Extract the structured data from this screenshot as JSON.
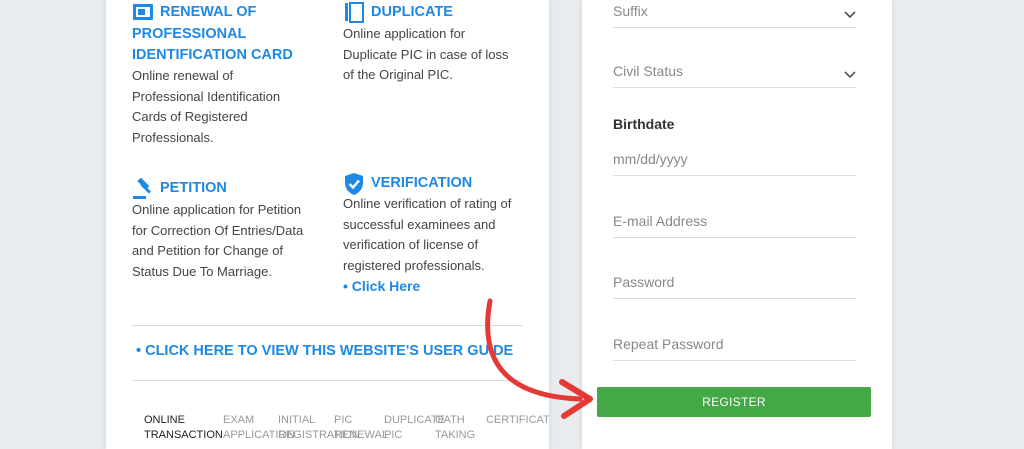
{
  "services": [
    {
      "id": "renewal",
      "icon": "id-card-icon",
      "title_lines": [
        "RENEWAL OF",
        "PROFESSIONAL",
        "IDENTIFICATION CARD"
      ],
      "desc_lines": [
        "Online renewal of",
        "Professional Identification",
        "Cards of Registered",
        "Professionals."
      ]
    },
    {
      "id": "duplicate",
      "icon": "duplicate-icon",
      "title_lines": [
        "DUPLICATE"
      ],
      "desc_lines": [
        "Online application for",
        "Duplicate PIC in case of loss",
        "of the Original PIC."
      ]
    },
    {
      "id": "petition",
      "icon": "gavel-icon",
      "title_lines": [
        "PETITION"
      ],
      "desc_lines": [
        "Online application for Petition",
        "for Correction Of Entries/Data",
        "and Petition for Change of",
        "Status Due To Marriage."
      ]
    },
    {
      "id": "verification",
      "icon": "verified-shield-icon",
      "title_lines": [
        "VERIFICATION"
      ],
      "desc_lines": [
        "Online verification of rating of",
        "successful examinees and",
        "verification of license of",
        "registered professionals."
      ],
      "link": "• Click Here"
    }
  ],
  "user_guide_link": "• CLICK HERE TO VIEW THIS WEBSITE'S USER GUIDE",
  "tabs": [
    {
      "lines": [
        "ONLINE",
        "TRANSACTION"
      ],
      "active": true
    },
    {
      "lines": [
        "EXAM",
        "APPLICATION"
      ],
      "active": false
    },
    {
      "lines": [
        "INITIAL",
        "REGISTRATION"
      ],
      "active": false
    },
    {
      "lines": [
        "PIC",
        "RENEWAL"
      ],
      "active": false
    },
    {
      "lines": [
        "DUPLICATE",
        "PIC"
      ],
      "active": false
    },
    {
      "lines": [
        "OATH",
        "TAKING"
      ],
      "active": false
    },
    {
      "lines": [
        "CERTIFICATION",
        ""
      ],
      "active": false
    }
  ],
  "form": {
    "suffix": "Suffix",
    "civil_status": "Civil Status",
    "birthdate_label": "Birthdate",
    "birthdate_placeholder": "mm/dd/yyyy",
    "email_placeholder": "E-mail Address",
    "password_placeholder": "Password",
    "repeat_password_placeholder": "Repeat Password",
    "register_label": "REGISTER"
  },
  "colors": {
    "accent": "#1e88e5",
    "button": "#43a845",
    "arrow": "#e53935"
  }
}
